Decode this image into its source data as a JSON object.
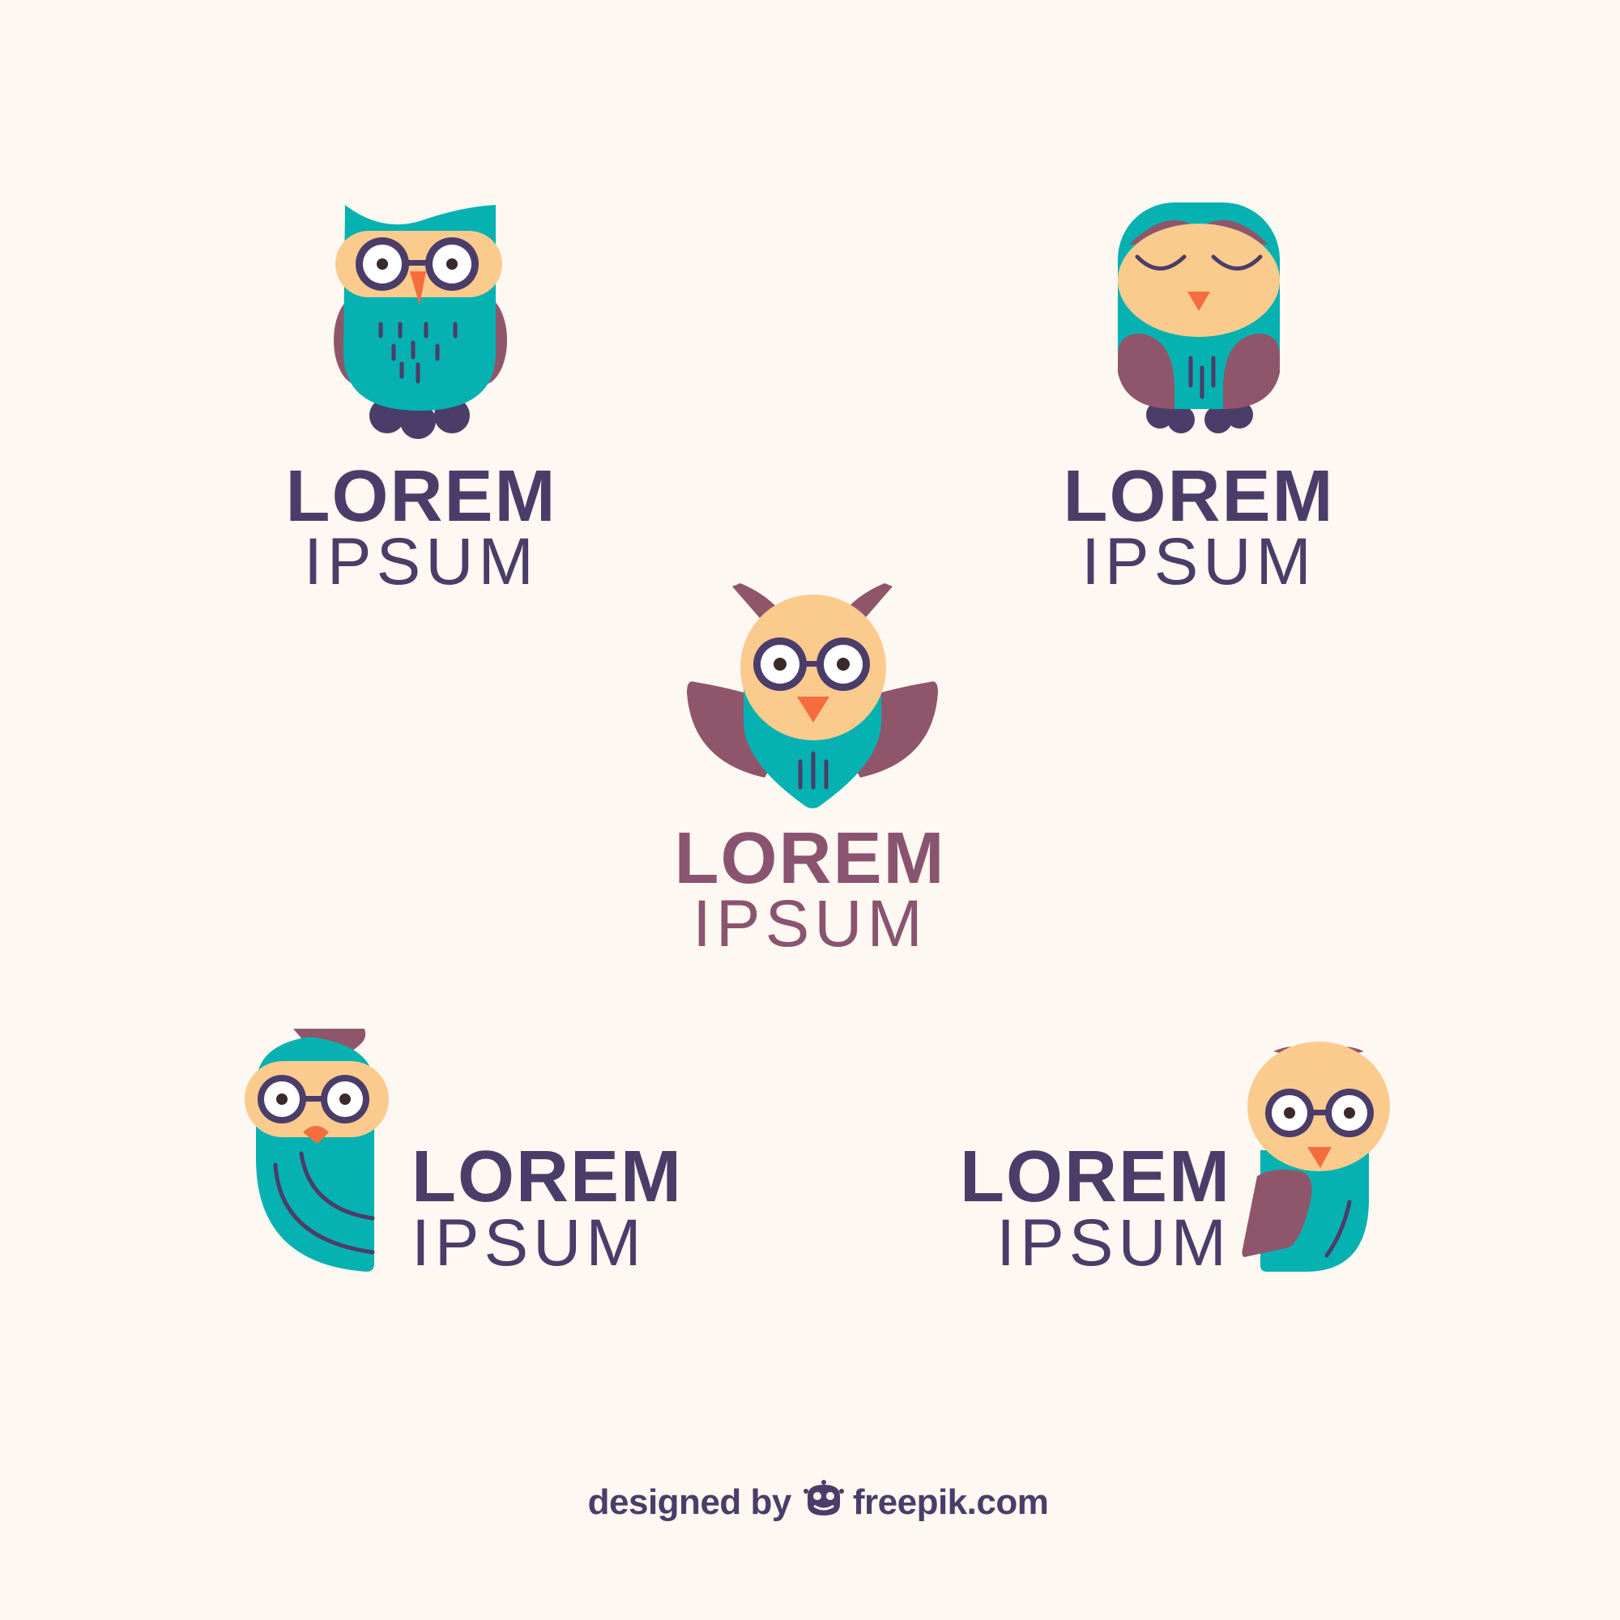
{
  "colors": {
    "background": "#fdf8f1",
    "teal": "#06b1b1",
    "mauve": "#8f566b",
    "peach": "#fbcb8e",
    "navy": "#4b3d69",
    "beak": "#f56d3f",
    "text_dark": "#4b3d69",
    "text_mauve": "#8a5470"
  },
  "logos": [
    {
      "id": "owl-glasses-standing",
      "title": "LOREM",
      "subtitle": "IPSUM",
      "text_color": "#4b3d69",
      "icon": "owl-with-glasses-icon"
    },
    {
      "id": "owl-sleeping",
      "title": "LOREM",
      "subtitle": "IPSUM",
      "text_color": "#4b3d69",
      "icon": "sleeping-owl-icon"
    },
    {
      "id": "owl-flying",
      "title": "LOREM",
      "subtitle": "IPSUM",
      "text_color": "#8a5470",
      "icon": "flying-owl-icon"
    },
    {
      "id": "owl-left-side",
      "title": "LOREM",
      "subtitle": "IPSUM",
      "text_color": "#4b3d69",
      "icon": "side-owl-icon"
    },
    {
      "id": "owl-right-side",
      "title": "LOREM",
      "subtitle": "IPSUM",
      "text_color": "#4b3d69",
      "icon": "perched-owl-icon"
    }
  ],
  "credit": {
    "prefix": "designed by",
    "brand": "freepik.com",
    "icon": "freepik-logo-icon"
  }
}
